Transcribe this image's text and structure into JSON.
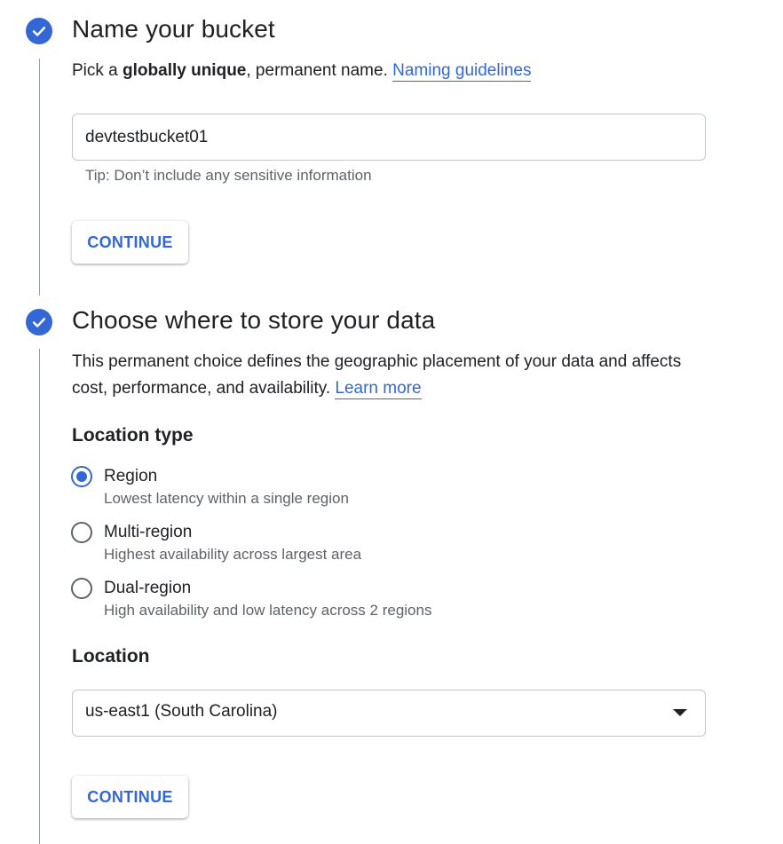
{
  "step1": {
    "title": "Name your bucket",
    "desc_prefix": "Pick a ",
    "desc_bold": "globally unique",
    "desc_suffix": ", permanent name. ",
    "link": "Naming guidelines",
    "input_value": "devtestbucket01",
    "tip": "Tip: Don’t include any sensitive information",
    "continue_label": "CONTINUE"
  },
  "step2": {
    "title": "Choose where to store your data",
    "desc": "This permanent choice defines the geographic placement of your data and affects cost, performance, and availability. ",
    "link": "Learn more",
    "location_type_label": "Location type",
    "options": [
      {
        "label": "Region",
        "sub": "Lowest latency within a single region",
        "checked": true
      },
      {
        "label": "Multi-region",
        "sub": "Highest availability across largest area",
        "checked": false
      },
      {
        "label": "Dual-region",
        "sub": "High availability and low latency across 2 regions",
        "checked": false
      }
    ],
    "location_label": "Location",
    "location_value": "us-east1 (South Carolina)",
    "continue_label": "CONTINUE"
  },
  "colors": {
    "accent": "#3367d6",
    "text": "#202124",
    "secondary_text": "#5f6368",
    "border": "#c4c7c9"
  },
  "icons": {
    "step_complete": "check-circle-icon",
    "dropdown": "caret-down-icon"
  }
}
